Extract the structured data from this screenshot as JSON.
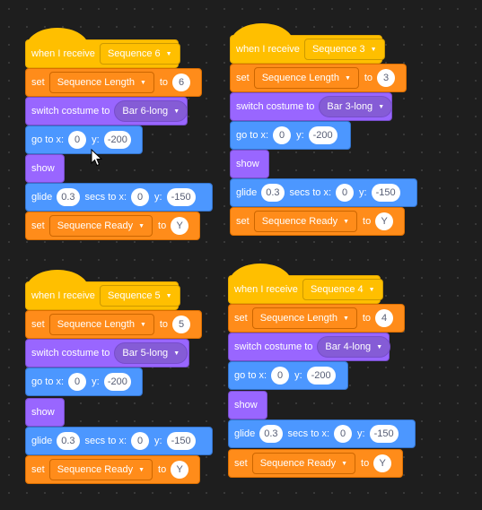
{
  "scripts": [
    {
      "hat_label": "when I receive",
      "message": "Sequence 6",
      "set_label": "set",
      "variable": "Sequence Length",
      "to_label": "to",
      "length_value": "6",
      "costume_label": "switch costume to",
      "costume": "Bar 6-long",
      "goto_label": "go to x:",
      "goto_x": "0",
      "y_label": "y:",
      "goto_y": "-200",
      "show_label": "show",
      "glide_label": "glide",
      "glide_secs": "0.3",
      "secs_label": "secs to x:",
      "glide_x": "0",
      "glide_y": "-150",
      "ready_set_label": "set",
      "ready_variable": "Sequence Ready",
      "ready_to_label": "to",
      "ready_value": "Y"
    },
    {
      "hat_label": "when I receive",
      "message": "Sequence 3",
      "set_label": "set",
      "variable": "Sequence Length",
      "to_label": "to",
      "length_value": "3",
      "costume_label": "switch costume to",
      "costume": "Bar 3-long",
      "goto_label": "go to x:",
      "goto_x": "0",
      "y_label": "y:",
      "goto_y": "-200",
      "show_label": "show",
      "glide_label": "glide",
      "glide_secs": "0.3",
      "secs_label": "secs to x:",
      "glide_x": "0",
      "glide_y": "-150",
      "ready_set_label": "set",
      "ready_variable": "Sequence Ready",
      "ready_to_label": "to",
      "ready_value": "Y"
    },
    {
      "hat_label": "when I receive",
      "message": "Sequence 5",
      "set_label": "set",
      "variable": "Sequence Length",
      "to_label": "to",
      "length_value": "5",
      "costume_label": "switch costume to",
      "costume": "Bar 5-long",
      "goto_label": "go to x:",
      "goto_x": "0",
      "y_label": "y:",
      "goto_y": "-200",
      "show_label": "show",
      "glide_label": "glide",
      "glide_secs": "0.3",
      "secs_label": "secs to x:",
      "glide_x": "0",
      "glide_y": "-150",
      "ready_set_label": "set",
      "ready_variable": "Sequence Ready",
      "ready_to_label": "to",
      "ready_value": "Y"
    },
    {
      "hat_label": "when I receive",
      "message": "Sequence 4",
      "set_label": "set",
      "variable": "Sequence Length",
      "to_label": "to",
      "length_value": "4",
      "costume_label": "switch costume to",
      "costume": "Bar 4-long",
      "goto_label": "go to x:",
      "goto_x": "0",
      "y_label": "y:",
      "goto_y": "-200",
      "show_label": "show",
      "glide_label": "glide",
      "glide_secs": "0.3",
      "secs_label": "secs to x:",
      "glide_x": "0",
      "glide_y": "-150",
      "ready_set_label": "set",
      "ready_variable": "Sequence Ready",
      "ready_to_label": "to",
      "ready_value": "Y"
    }
  ]
}
